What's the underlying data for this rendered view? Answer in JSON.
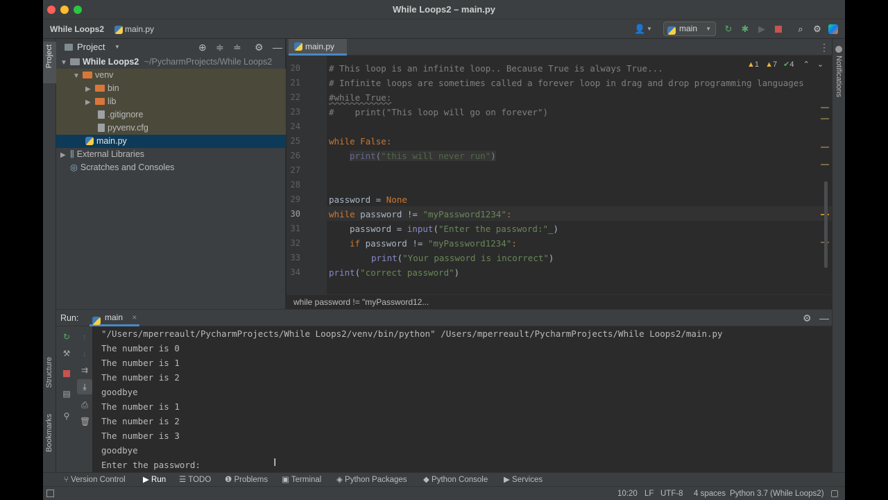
{
  "window": {
    "title": "While Loops2 – main.py",
    "colors": {
      "close": "#ff5f57",
      "minimize": "#febc2e",
      "zoom": "#28c840"
    }
  },
  "navbar": {
    "project": "While Loops2",
    "file": "main.py",
    "branch": "main",
    "icons": [
      "user-icon",
      "rerun-icon",
      "debug-icon",
      "coverage-icon",
      "stop-icon",
      "search-icon",
      "gear-icon",
      "jetbrains-icon"
    ]
  },
  "stripes": {
    "left_top": "Project",
    "left_structure": "Structure",
    "left_bookmarks": "Bookmarks",
    "right": "Notifications"
  },
  "project_panel": {
    "title": "Project",
    "tree": [
      {
        "label": "While Loops2",
        "path": "~/PycharmProjects/While Loops2",
        "type": "root"
      },
      {
        "label": "venv",
        "type": "folder"
      },
      {
        "label": "bin",
        "type": "folder"
      },
      {
        "label": "lib",
        "type": "folder"
      },
      {
        "label": ".gitignore",
        "type": "file"
      },
      {
        "label": "pyvenv.cfg",
        "type": "file"
      },
      {
        "label": "main.py",
        "type": "python"
      },
      {
        "label": "External Libraries",
        "type": "library"
      },
      {
        "label": "Scratches and Consoles",
        "type": "scratch"
      }
    ]
  },
  "editor": {
    "tab": "main.py",
    "inspections": {
      "warnings": "1",
      "weak_warnings": "7",
      "ok": "4"
    },
    "line_numbers": [
      "20",
      "21",
      "22",
      "23",
      "24",
      "25",
      "26",
      "27",
      "28",
      "29",
      "30",
      "31",
      "32",
      "33",
      "34"
    ],
    "current_line": "30",
    "code": {
      "l20": "# This loop is an infinite loop.. Because True is always True...",
      "l21": "# Infinite loops are sometimes called a forever loop in drag and drop programming languages",
      "l22": "#while True:",
      "l23": "#    print(\"This loop will go on forever\")",
      "l25_kw": "while",
      "l25_val": "False",
      "l25_rest": ":",
      "l26_fn": "print",
      "l26_open": "(",
      "l26_str": "\"this will never run\"",
      "l26_close": ")",
      "l29_var": "password = ",
      "l29_val": "None",
      "l30_kw": "while",
      "l30_mid": " password != ",
      "l30_str": "\"myPassword1234\"",
      "l30_end": ":",
      "l31_var": "password = ",
      "l31_fn": "input",
      "l31_open": "(",
      "l31_str": "\"Enter the password:\"",
      "l31_close": "_)",
      "l32_kw": "if",
      "l32_mid": " password != ",
      "l32_str": "\"myPassword1234\"",
      "l32_end": ":",
      "l33_fn": "print",
      "l33_open": "(",
      "l33_str": "\"Your password is incorrect\"",
      "l33_close": ")",
      "l34_fn": "print",
      "l34_open": "(",
      "l34_str": "\"correct password\"",
      "l34_close": ")"
    },
    "breadcrumb": "while password != \"myPassword12..."
  },
  "run_panel": {
    "label": "Run:",
    "tab": "main",
    "console": [
      "\"/Users/mperreault/PycharmProjects/While Loops2/venv/bin/python\" /Users/mperreault/PycharmProjects/While Loops2/main.py",
      "The number is 0",
      "The number is 1",
      "The number is 2",
      "goodbye",
      "The number is 1",
      "The number is 2",
      "The number is 3",
      "goodbye",
      "Enter the password:"
    ]
  },
  "bottom_tools": {
    "version_control": "Version Control",
    "run": "Run",
    "todo": "TODO",
    "problems": "Problems",
    "terminal": "Terminal",
    "python_packages": "Python Packages",
    "python_console": "Python Console",
    "services": "Services"
  },
  "status": {
    "position": "10:20",
    "line_sep": "LF",
    "encoding": "UTF-8",
    "indent": "4 spaces",
    "interpreter": "Python 3.7 (While Loops2)"
  }
}
